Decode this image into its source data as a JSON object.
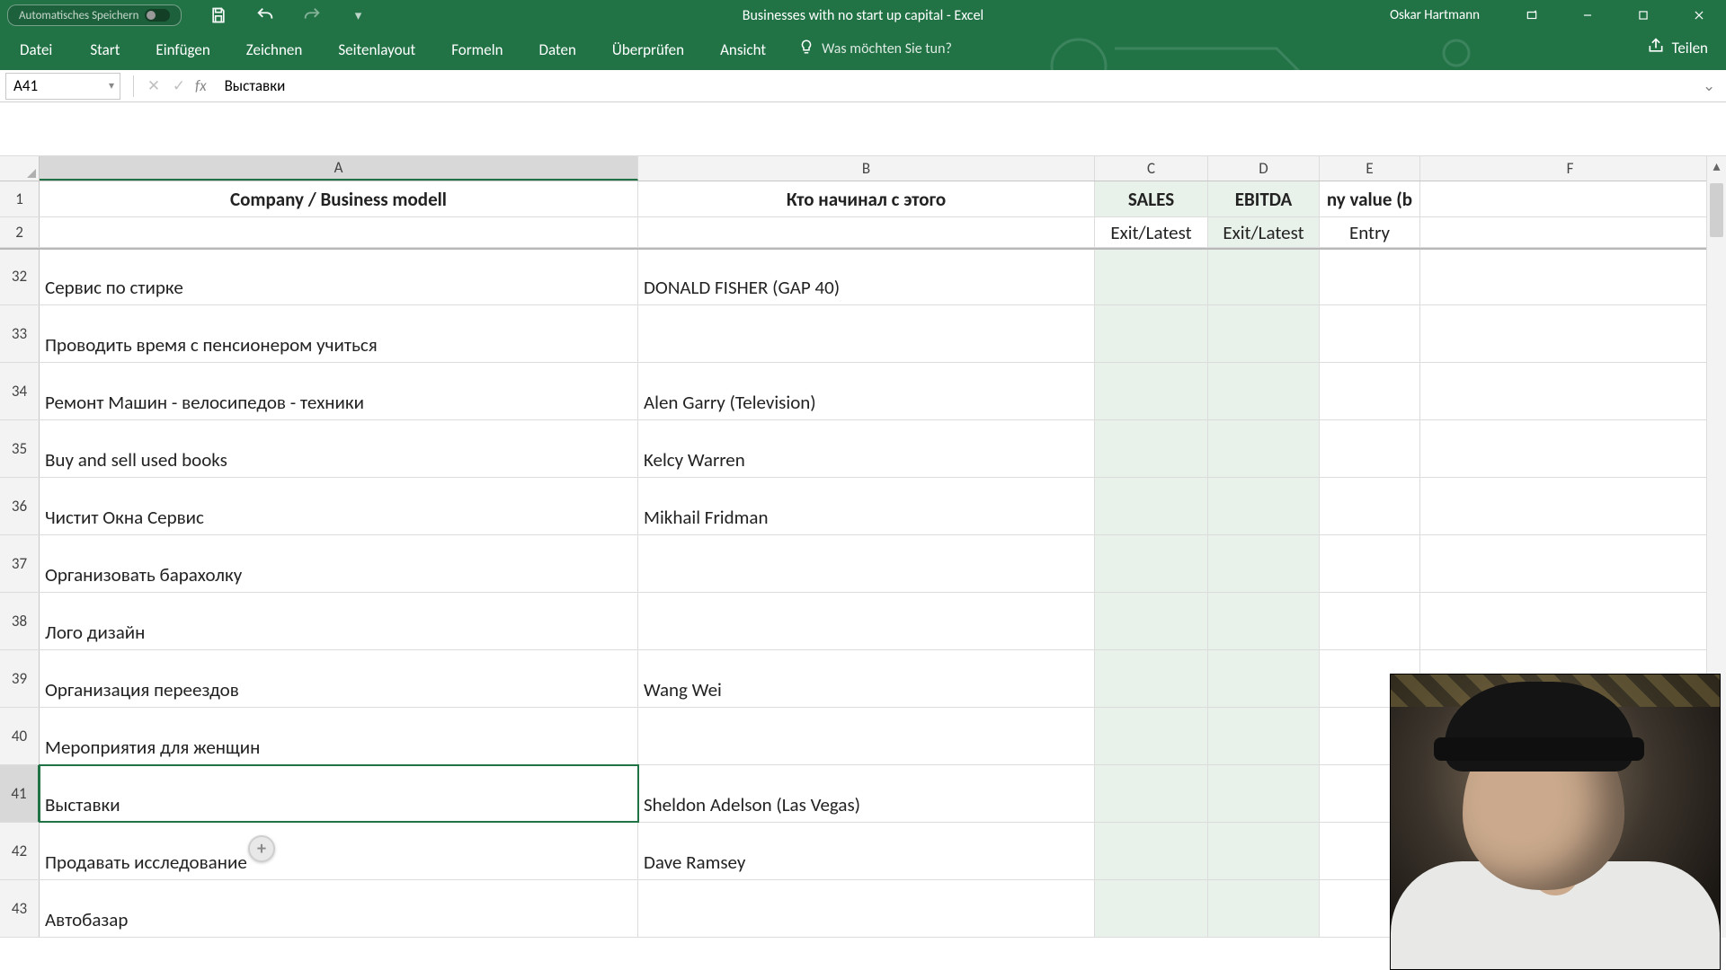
{
  "titlebar": {
    "autosave_label": "Automatisches Speichern",
    "doc_title": "Businesses with no start up capital  -  Excel",
    "user": "Oskar Hartmann"
  },
  "ribbon": {
    "file": "Datei",
    "tabs": [
      "Start",
      "Einfügen",
      "Zeichnen",
      "Seitenlayout",
      "Formeln",
      "Daten",
      "Überprüfen",
      "Ansicht"
    ],
    "tellme": "Was möchten Sie tun?",
    "share": "Teilen"
  },
  "fbar": {
    "cellref": "A41",
    "fx": "fx",
    "formula": "Выставки"
  },
  "columns": [
    "A",
    "B",
    "C",
    "D",
    "E",
    "F"
  ],
  "headers": {
    "row1": {
      "A": "Company  / Business modell",
      "B": "Кто начинал с этого",
      "C": "SALES",
      "D": "EBITDA",
      "E": "ny value (b"
    },
    "row2": {
      "C": "Exit/Latest",
      "D": "Exit/Latest",
      "E": "Entry"
    }
  },
  "rows": [
    {
      "n": 32,
      "A": "Сервис по стирке",
      "B": "DONALD FISHER (GAP 40)"
    },
    {
      "n": 33,
      "A": "Проводить время с пенсионером учиться",
      "B": ""
    },
    {
      "n": 34,
      "A": "Ремонт Машин - велосипедов - техники",
      "B": "Alen Garry (Television)"
    },
    {
      "n": 35,
      "A": "Buy and sell used books",
      "B": " Kelcy Warren"
    },
    {
      "n": 36,
      "A": "Чистит Окна Сервис",
      "B": "Mikhail Fridman"
    },
    {
      "n": 37,
      "A": "Организовать барахолку",
      "B": ""
    },
    {
      "n": 38,
      "A": "Лого дизайн",
      "B": ""
    },
    {
      "n": 39,
      "A": "Организация переездов",
      "B": "Wang Wei"
    },
    {
      "n": 40,
      "A": "Мероприятия для женщин",
      "B": ""
    },
    {
      "n": 41,
      "A": "Выставки",
      "B": "Sheldon Adelson (Las Vegas)"
    },
    {
      "n": 42,
      "A": "Продавать исследование",
      "B": "Dave Ramsey"
    },
    {
      "n": 43,
      "A": "Автобазар",
      "B": ""
    }
  ],
  "selected_row": 41
}
